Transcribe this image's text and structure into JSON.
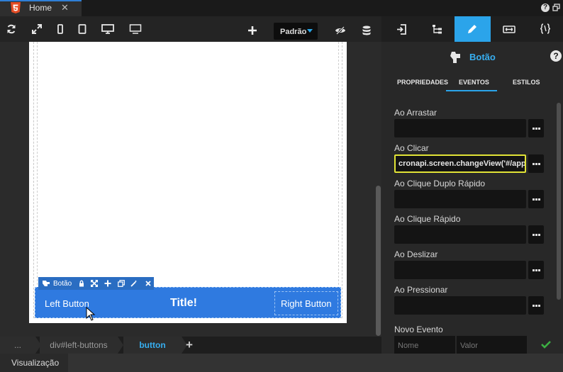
{
  "tab": {
    "label": "Home",
    "close": "✕"
  },
  "toolbar": {
    "preset": "Padrão"
  },
  "canvas": {
    "element_toolbar_name": "Botão",
    "left_button": "Left Button",
    "title": "Title!",
    "right_button": "Right Button"
  },
  "breadcrumb": {
    "items": [
      "...",
      "div#left-buttons",
      "button"
    ],
    "add": "+"
  },
  "bottom": {
    "view_label": "Visualização"
  },
  "panel": {
    "title": "Botão",
    "help": "?",
    "subtabs": [
      "PROPRIEDADES",
      "EVENTOS",
      "ESTILOS"
    ],
    "active_subtab": "EVENTOS",
    "events": [
      {
        "label": "Ao Arrastar",
        "value": ""
      },
      {
        "label": "Ao Clicar",
        "value": "cronapi.screen.changeView('#/app/"
      },
      {
        "label": "Ao Clique Duplo Rápido",
        "value": ""
      },
      {
        "label": "Ao Clique Rápido",
        "value": ""
      },
      {
        "label": "Ao Deslizar",
        "value": ""
      },
      {
        "label": "Ao Pressionar",
        "value": ""
      }
    ],
    "new_event": {
      "label": "Novo Evento",
      "name_placeholder": "Nome",
      "value_placeholder": "Valor"
    }
  },
  "colors": {
    "accent": "#2ba4ea",
    "button_bar": "#2f7ae0",
    "highlight_border": "#e1e336",
    "confirm": "#3cb043"
  },
  "icons": [
    "html5-icon",
    "refresh-icon",
    "expand-icon",
    "phone-icon",
    "tablet-icon",
    "desktop-icon",
    "monitor-icon",
    "plus-icon",
    "eye-slash-icon",
    "database-icon",
    "login-icon",
    "tree-icon",
    "pencil-icon",
    "resize-icon",
    "code-icon",
    "hand-icon",
    "lock-icon",
    "move-icon",
    "copy-icon",
    "magic-wand-icon",
    "check-icon"
  ]
}
